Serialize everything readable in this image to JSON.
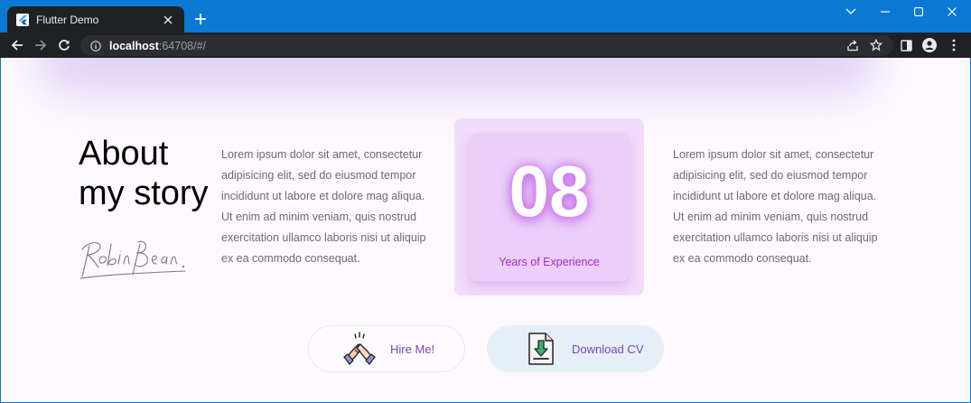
{
  "browser": {
    "tab_title": "Flutter Demo",
    "url_host": "localhost",
    "url_rest": ":64708/#/"
  },
  "about": {
    "title_line1": "About",
    "title_line2": "my story",
    "signature_text": "Robin Bean"
  },
  "paragraph_left": "Lorem ipsum dolor sit amet, consectetur adipisicing elit, sed do eiusmod tempor incididunt ut labore et dolore mag aliqua. Ut enim ad minim veniam, quis nostrud exercitation ullamco laboris nisi ut aliquip ex ea commodo consequat.",
  "paragraph_right": "Lorem ipsum dolor sit amet, consectetur adipisicing elit, sed do eiusmod tempor incididunt ut labore et dolore mag aliqua. Ut enim ad minim veniam, quis nostrud exercitation ullamco laboris nisi ut aliquip ex ea commodo consequat.",
  "experience": {
    "number": "08",
    "label": "Years of Experience"
  },
  "buttons": {
    "hire_label": "Hire Me!",
    "cv_label": "Download CV"
  },
  "colors": {
    "accent_text": "#7847b8",
    "experience_label": "#a62cc9",
    "browser_blue": "#0b78d4"
  },
  "icons": [
    "flutter-favicon",
    "close-icon",
    "plus-icon",
    "chevron-down-icon",
    "minimize-icon",
    "maximize-icon",
    "window-close-icon",
    "back-arrow-icon",
    "forward-arrow-icon",
    "reload-icon",
    "info-icon",
    "share-icon",
    "star-icon",
    "side-panel-icon",
    "profile-icon",
    "more-vert-icon",
    "handshake-icon",
    "download-file-icon"
  ]
}
